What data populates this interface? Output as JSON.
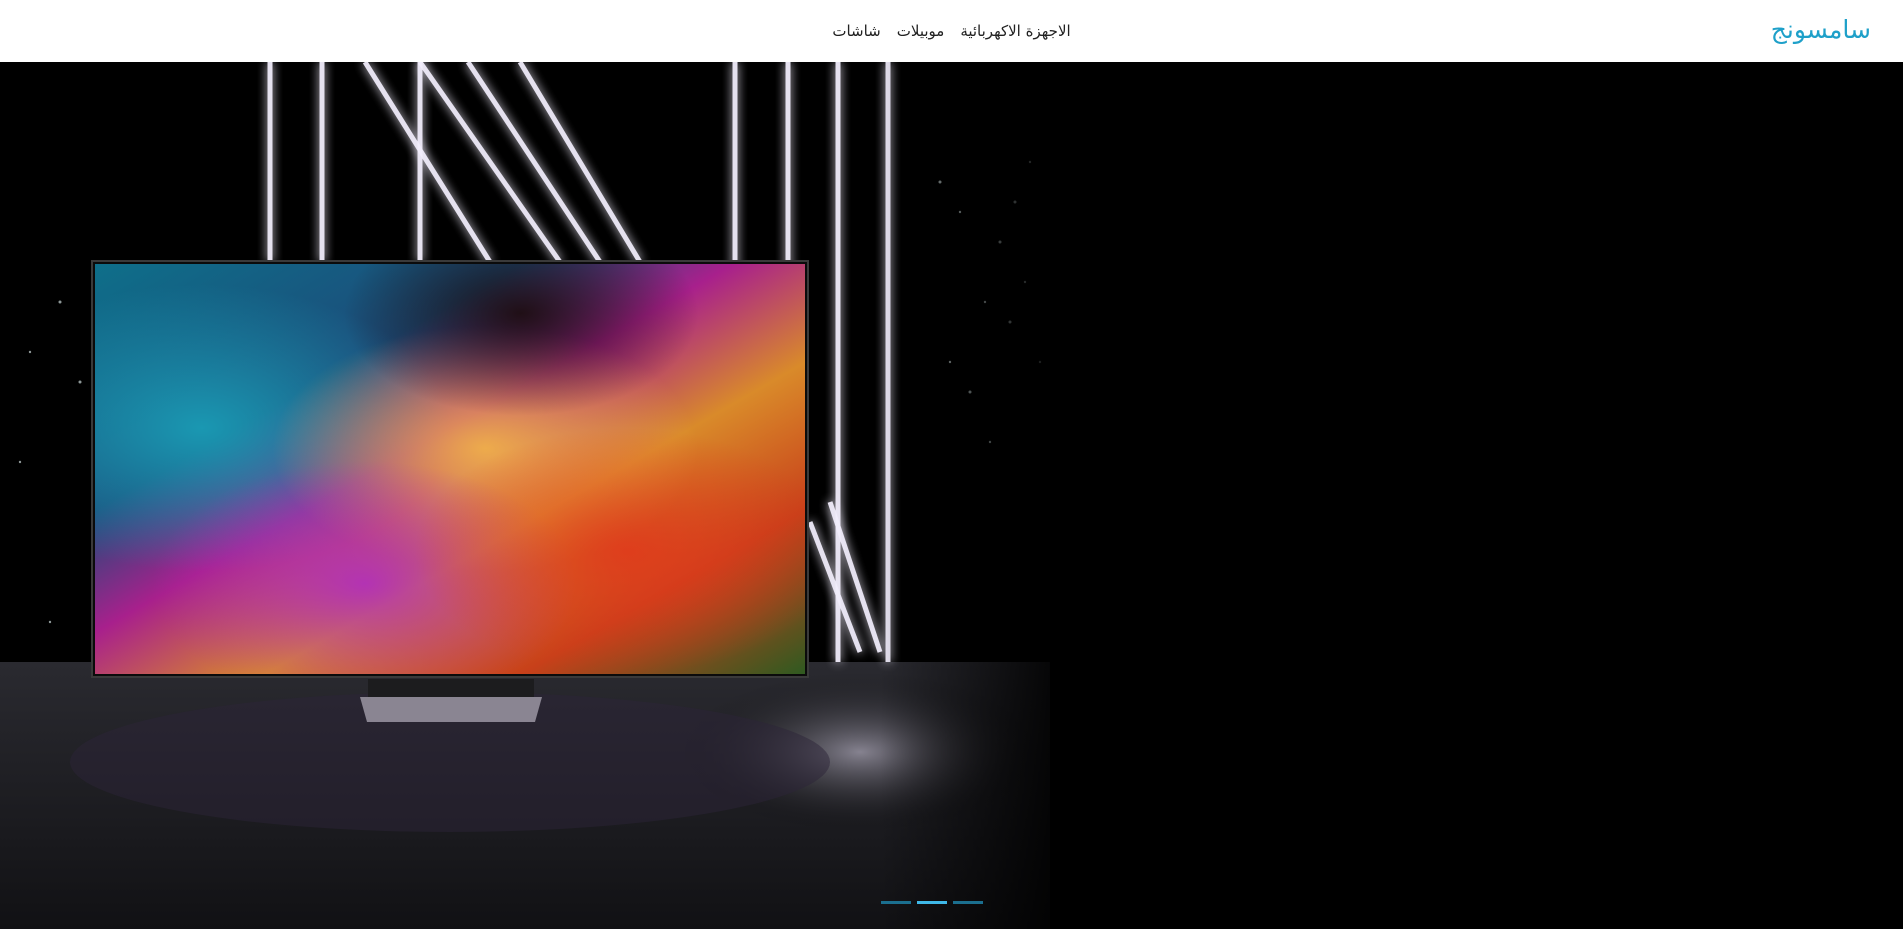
{
  "brand": {
    "name": "سامسونج",
    "color": "#1ea0c9"
  },
  "nav": {
    "links": [
      {
        "label": "الاجهزة الاكهربائية"
      },
      {
        "label": "موبيلات"
      },
      {
        "label": "شاشات"
      }
    ]
  },
  "carousel": {
    "slide_count": 3,
    "active_index": 1,
    "indicator_colors": {
      "inactive": "#1b6f8f",
      "active": "#3fb8e8"
    }
  },
  "hero": {
    "image": "samsung-tv-neon-lights"
  }
}
